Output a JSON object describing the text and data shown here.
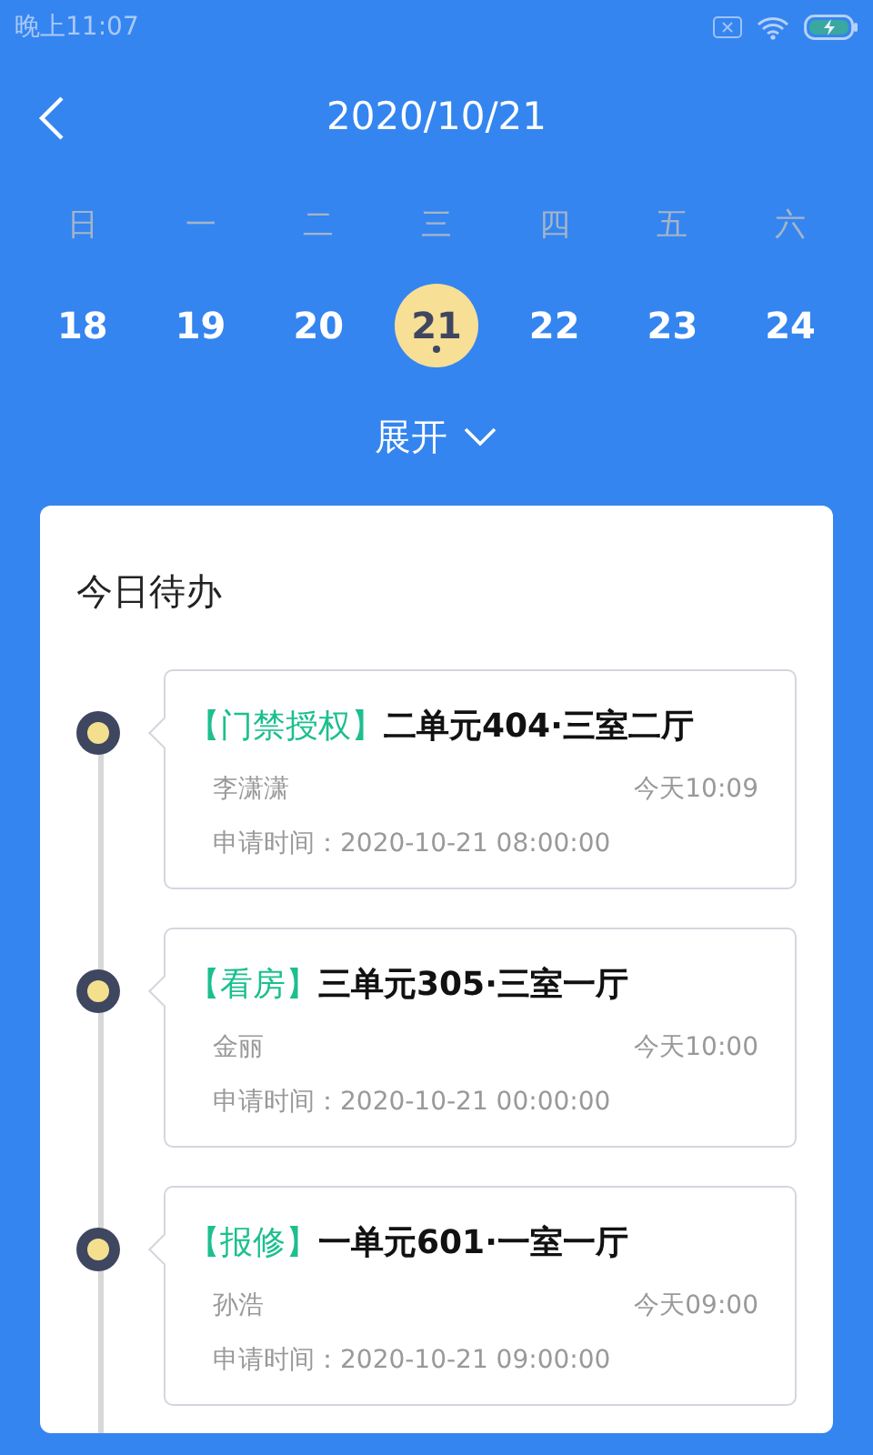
{
  "status_bar": {
    "time": "晚上11:07"
  },
  "header": {
    "title": "2020/10/21"
  },
  "week": {
    "weekdays": [
      "日",
      "一",
      "二",
      "三",
      "四",
      "五",
      "六"
    ],
    "days": [
      {
        "label": "18",
        "selected": false,
        "has_event": false
      },
      {
        "label": "19",
        "selected": false,
        "has_event": false
      },
      {
        "label": "20",
        "selected": false,
        "has_event": false
      },
      {
        "label": "21",
        "selected": true,
        "has_event": true
      },
      {
        "label": "22",
        "selected": false,
        "has_event": false
      },
      {
        "label": "23",
        "selected": false,
        "has_event": false
      },
      {
        "label": "24",
        "selected": false,
        "has_event": false
      }
    ],
    "expand_label": "展开"
  },
  "todo": {
    "title": "今日待办",
    "items": [
      {
        "tag": "【门禁授权】",
        "address": "二单元404·三室二厅",
        "person": "李潇潇",
        "time": "今天10:09",
        "applied": "申请时间：2020-10-21 08:00:00"
      },
      {
        "tag": "【看房】",
        "address": "三单元305·三室一厅",
        "person": "金丽",
        "time": "今天10:00",
        "applied": "申请时间：2020-10-21 00:00:00"
      },
      {
        "tag": "【报修】",
        "address": "一单元601·一室一厅",
        "person": "孙浩",
        "time": "今天09:00",
        "applied": "申请时间：2020-10-21 09:00:00"
      }
    ]
  }
}
